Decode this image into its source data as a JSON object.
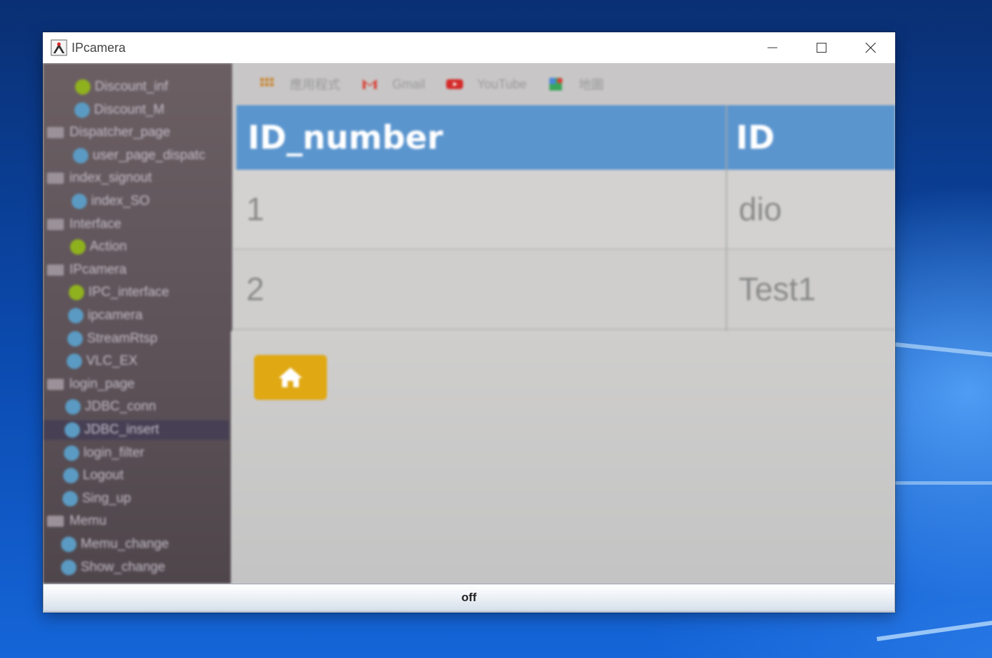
{
  "window": {
    "title": "IPcamera",
    "icon": "java-duke-icon"
  },
  "camera_feed": {
    "ide_tree": [
      {
        "label": "Discount_inf",
        "kind": "green-dot"
      },
      {
        "label": "Discount_M",
        "kind": "blue-dot"
      },
      {
        "label": "Dispatcher_page",
        "kind": "folder"
      },
      {
        "label": "user_page_dispatc",
        "kind": "blue-dot"
      },
      {
        "label": "index_signout",
        "kind": "folder"
      },
      {
        "label": "index_SO",
        "kind": "blue-dot"
      },
      {
        "label": "Interface",
        "kind": "folder"
      },
      {
        "label": "Action",
        "kind": "green-dot"
      },
      {
        "label": "IPcamera",
        "kind": "folder"
      },
      {
        "label": "IPC_interface",
        "kind": "green-dot"
      },
      {
        "label": "ipcamera",
        "kind": "blue-dot"
      },
      {
        "label": "StreamRtsp",
        "kind": "blue-dot"
      },
      {
        "label": "VLC_EX",
        "kind": "blue-dot"
      },
      {
        "label": "login_page",
        "kind": "folder"
      },
      {
        "label": "JDBC_conn",
        "kind": "blue-dot"
      },
      {
        "label": "JDBC_insert",
        "kind": "blue-dot"
      },
      {
        "label": "login_filter",
        "kind": "blue-dot"
      },
      {
        "label": "Logout",
        "kind": "blue-dot"
      },
      {
        "label": "Sing_up",
        "kind": "blue-dot"
      },
      {
        "label": "Memu",
        "kind": "folder"
      },
      {
        "label": "Memu_change",
        "kind": "blue-dot"
      },
      {
        "label": "Show_change",
        "kind": "blue-dot"
      }
    ],
    "bookmarks": [
      {
        "label": "應用程式",
        "icon": "apps-grid-icon"
      },
      {
        "label": "Gmail",
        "icon": "gmail-icon"
      },
      {
        "label": "YouTube",
        "icon": "youtube-icon"
      },
      {
        "label": "地圖",
        "icon": "maps-icon"
      }
    ],
    "table": {
      "headers": [
        "ID_number",
        "ID"
      ],
      "rows": [
        [
          "1",
          "dio"
        ],
        [
          "2",
          "Test1"
        ]
      ]
    },
    "home_button_icon": "home-icon"
  },
  "off_button": {
    "label": "off"
  },
  "colors": {
    "table_header": "#5b95ce",
    "home_button": "#e0a812",
    "ide_background": "#5b5157"
  }
}
